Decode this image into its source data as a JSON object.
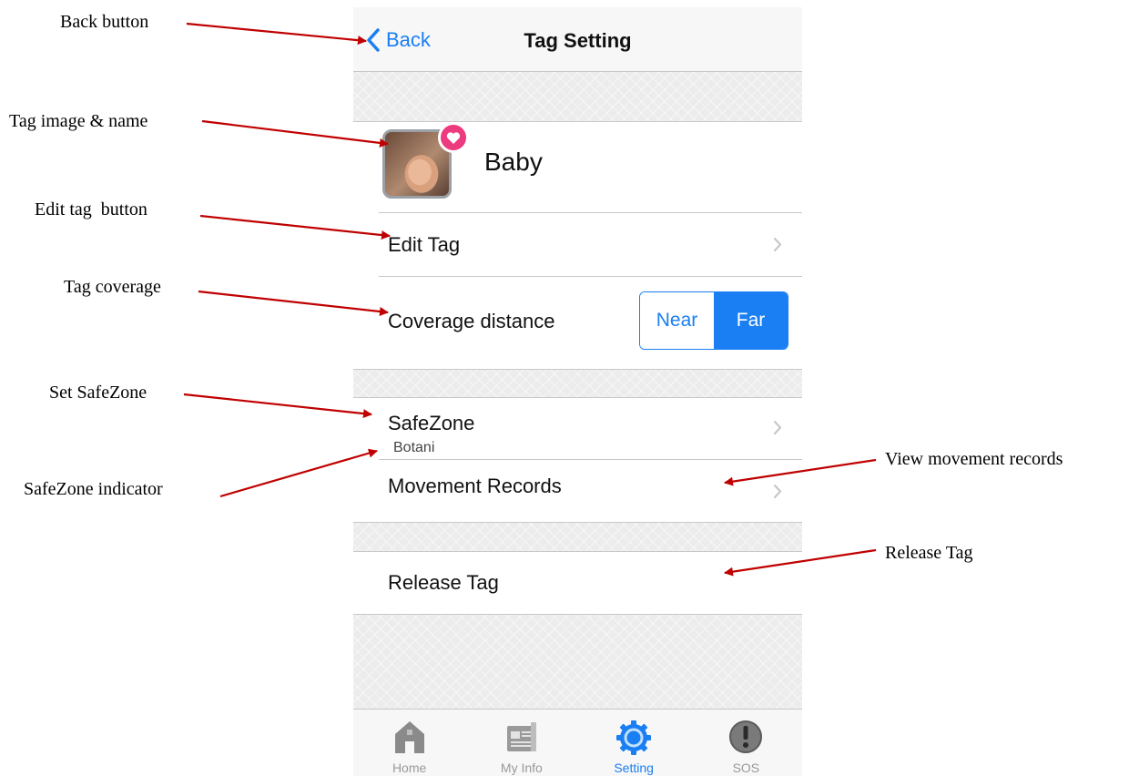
{
  "annotations": {
    "back_button": "Back button",
    "tag_image_name": "Tag image & name",
    "edit_tag_button": "Edit tag  button",
    "tag_coverage": "Tag coverage",
    "set_safezone": "Set SafeZone",
    "safezone_indicator": "SafeZone indicator",
    "view_movement_records": "View movement records",
    "release_tag": "Release Tag"
  },
  "navbar": {
    "back_label": "Back",
    "title": "Tag Setting"
  },
  "tag": {
    "name": "Baby"
  },
  "rows": {
    "edit_tag": "Edit Tag",
    "coverage": "Coverage distance",
    "safezone": "SafeZone",
    "safezone_value": "Botani",
    "movement_records": "Movement Records",
    "release_tag": "Release Tag"
  },
  "coverage_segment": {
    "options": [
      "Near",
      "Far"
    ],
    "selected": "Far"
  },
  "tabbar": {
    "items": [
      {
        "label": "Home",
        "icon": "home-icon"
      },
      {
        "label": "My Info",
        "icon": "news-icon"
      },
      {
        "label": "Setting",
        "icon": "gear-icon"
      },
      {
        "label": "SOS",
        "icon": "alert-icon"
      }
    ],
    "active": "Setting"
  },
  "colors": {
    "accent": "#1a7ff2",
    "arrow": "#c00000",
    "badge": "#ec3b7f"
  }
}
